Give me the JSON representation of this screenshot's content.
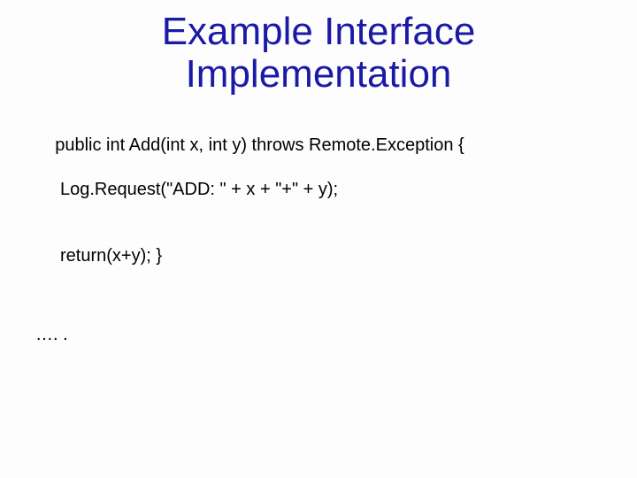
{
  "title_line1": "Example Interface",
  "title_line2": "Implementation",
  "code": {
    "line1": "public int Add(int x, int y) throws Remote.Exception {",
    "line2": "Log.Request(\"ADD: \" + x + \"+\" + y);",
    "line3": "return(x+y); }",
    "ellipsis": "…. ."
  }
}
